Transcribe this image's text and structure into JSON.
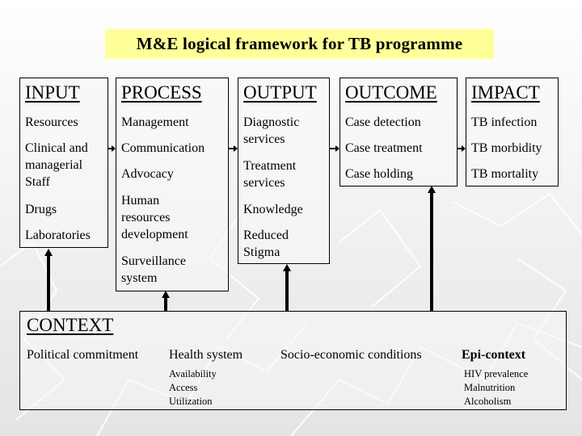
{
  "title": "M&E logical framework for TB programme",
  "colors": {
    "title_bg": "#ffff99",
    "border": "#000000",
    "arrow": "#000000"
  },
  "columns": [
    {
      "id": "input",
      "heading": "INPUT",
      "items": [
        "Resources",
        "Clinical and managerial Staff",
        "Drugs",
        "Laboratories"
      ]
    },
    {
      "id": "process",
      "heading": "PROCESS",
      "items": [
        "Management",
        "Communication",
        "Advocacy",
        "Human resources development",
        "Surveillance system"
      ]
    },
    {
      "id": "output",
      "heading": "OUTPUT",
      "items": [
        "Diagnostic services",
        "Treatment services",
        "Knowledge",
        "Reduced Stigma"
      ]
    },
    {
      "id": "outcome",
      "heading": "OUTCOME",
      "items": [
        "Case detection",
        "Case treatment",
        "Case holding"
      ]
    },
    {
      "id": "impact",
      "heading": "IMPACT",
      "items": [
        "TB infection",
        "TB morbidity",
        "TB mortality"
      ]
    }
  ],
  "context": {
    "heading": "CONTEXT",
    "groups": [
      {
        "title": "Political commitment",
        "subitems": []
      },
      {
        "title": "Health system",
        "subitems": [
          "Availability",
          "Access",
          "Utilization"
        ]
      },
      {
        "title": "Socio-economic conditions",
        "subitems": []
      },
      {
        "title": "Epi-context",
        "subitems": [
          "HIV prevalence",
          "Malnutrition",
          "Alcoholism"
        ]
      }
    ]
  },
  "connections": [
    {
      "from": "input",
      "to": "process"
    },
    {
      "from": "process",
      "to": "output"
    },
    {
      "from": "output",
      "to": "outcome"
    },
    {
      "from": "outcome",
      "to": "impact"
    },
    {
      "from": "context",
      "to": "input"
    },
    {
      "from": "context",
      "to": "process"
    },
    {
      "from": "context",
      "to": "output"
    },
    {
      "from": "context",
      "to": "outcome"
    }
  ]
}
